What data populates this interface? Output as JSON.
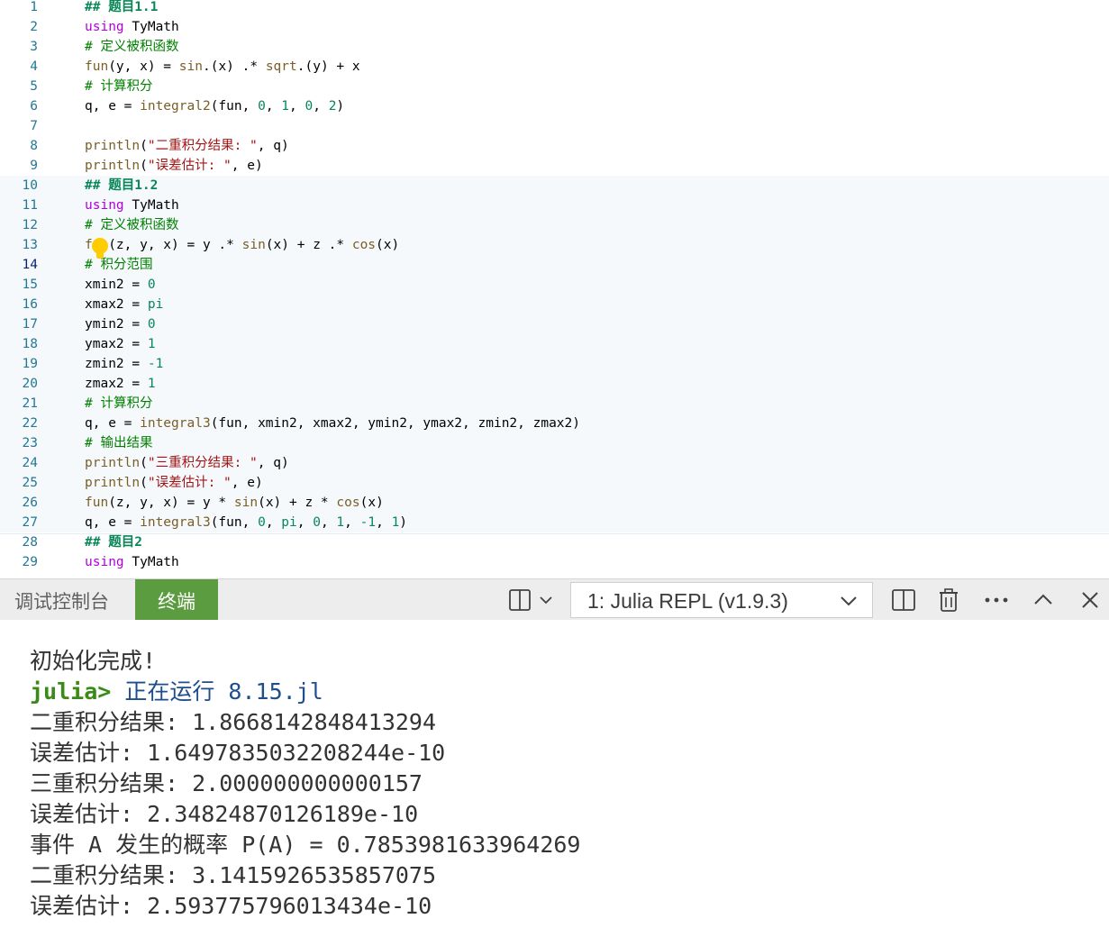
{
  "editor": {
    "lines": [
      {
        "num": "1",
        "code": [
          {
            "t": "## 题目1.1",
            "c": "hd"
          }
        ]
      },
      {
        "num": "2",
        "code": [
          {
            "t": "using",
            "c": "kw"
          },
          {
            "t": " TyMath",
            "c": "tx"
          }
        ]
      },
      {
        "num": "3",
        "code": [
          {
            "t": "# 定义被积函数",
            "c": "cm"
          }
        ]
      },
      {
        "num": "4",
        "code": [
          {
            "t": "fun",
            "c": "fn"
          },
          {
            "t": "(y, x) = ",
            "c": "tx"
          },
          {
            "t": "sin",
            "c": "fn"
          },
          {
            "t": ".(x) .* ",
            "c": "tx"
          },
          {
            "t": "sqrt",
            "c": "fn"
          },
          {
            "t": ".(y) + x",
            "c": "tx"
          }
        ]
      },
      {
        "num": "5",
        "code": [
          {
            "t": "# 计算积分",
            "c": "cm"
          }
        ]
      },
      {
        "num": "6",
        "code": [
          {
            "t": "q, e = ",
            "c": "tx"
          },
          {
            "t": "integral2",
            "c": "fn"
          },
          {
            "t": "(fun, ",
            "c": "tx"
          },
          {
            "t": "0",
            "c": "nm"
          },
          {
            "t": ", ",
            "c": "tx"
          },
          {
            "t": "1",
            "c": "nm"
          },
          {
            "t": ", ",
            "c": "tx"
          },
          {
            "t": "0",
            "c": "nm"
          },
          {
            "t": ", ",
            "c": "tx"
          },
          {
            "t": "2",
            "c": "nm"
          },
          {
            "t": ")",
            "c": "tx"
          }
        ]
      },
      {
        "num": "7",
        "code": []
      },
      {
        "num": "8",
        "code": [
          {
            "t": "println",
            "c": "fn"
          },
          {
            "t": "(",
            "c": "tx"
          },
          {
            "t": "\"二重积分结果: \"",
            "c": "st"
          },
          {
            "t": ", q)",
            "c": "tx"
          }
        ]
      },
      {
        "num": "9",
        "code": [
          {
            "t": "println",
            "c": "fn"
          },
          {
            "t": "(",
            "c": "tx"
          },
          {
            "t": "\"误差估计: \"",
            "c": "st"
          },
          {
            "t": ", e)",
            "c": "tx"
          }
        ]
      },
      {
        "num": "10",
        "code": [
          {
            "t": "## 题目1.2",
            "c": "hd"
          }
        ]
      },
      {
        "num": "11",
        "code": [
          {
            "t": "using",
            "c": "kw"
          },
          {
            "t": " TyMath",
            "c": "tx"
          }
        ]
      },
      {
        "num": "12",
        "code": [
          {
            "t": "# 定义被积函数",
            "c": "cm"
          }
        ]
      },
      {
        "num": "13",
        "code": [
          {
            "t": "f  ",
            "c": "fn"
          },
          {
            "t": "(z, y, x) = y .* ",
            "c": "tx"
          },
          {
            "t": "sin",
            "c": "fn"
          },
          {
            "t": "(x) + z .* ",
            "c": "tx"
          },
          {
            "t": "cos",
            "c": "fn"
          },
          {
            "t": "(x)",
            "c": "tx"
          }
        ]
      },
      {
        "num": "14",
        "code": [
          {
            "t": "# 积分范围",
            "c": "cm"
          }
        ]
      },
      {
        "num": "15",
        "code": [
          {
            "t": "xmin2 = ",
            "c": "tx"
          },
          {
            "t": "0",
            "c": "nm"
          }
        ]
      },
      {
        "num": "16",
        "code": [
          {
            "t": "xmax2 = ",
            "c": "tx"
          },
          {
            "t": "pi",
            "c": "nm"
          }
        ]
      },
      {
        "num": "17",
        "code": [
          {
            "t": "ymin2 = ",
            "c": "tx"
          },
          {
            "t": "0",
            "c": "nm"
          }
        ]
      },
      {
        "num": "18",
        "code": [
          {
            "t": "ymax2 = ",
            "c": "tx"
          },
          {
            "t": "1",
            "c": "nm"
          }
        ]
      },
      {
        "num": "19",
        "code": [
          {
            "t": "zmin2 = ",
            "c": "tx"
          },
          {
            "t": "-1",
            "c": "nm"
          }
        ]
      },
      {
        "num": "20",
        "code": [
          {
            "t": "zmax2 = ",
            "c": "tx"
          },
          {
            "t": "1",
            "c": "nm"
          }
        ]
      },
      {
        "num": "21",
        "code": [
          {
            "t": "# 计算积分",
            "c": "cm"
          }
        ]
      },
      {
        "num": "22",
        "code": [
          {
            "t": "q, e = ",
            "c": "tx"
          },
          {
            "t": "integral3",
            "c": "fn"
          },
          {
            "t": "(fun, xmin2, xmax2, ymin2, ymax2, zmin2, zmax2)",
            "c": "tx"
          }
        ]
      },
      {
        "num": "23",
        "code": [
          {
            "t": "# 输出结果",
            "c": "cm"
          }
        ]
      },
      {
        "num": "24",
        "code": [
          {
            "t": "println",
            "c": "fn"
          },
          {
            "t": "(",
            "c": "tx"
          },
          {
            "t": "\"三重积分结果: \"",
            "c": "st"
          },
          {
            "t": ", q)",
            "c": "tx"
          }
        ]
      },
      {
        "num": "25",
        "code": [
          {
            "t": "println",
            "c": "fn"
          },
          {
            "t": "(",
            "c": "tx"
          },
          {
            "t": "\"误差估计: \"",
            "c": "st"
          },
          {
            "t": ", e)",
            "c": "tx"
          }
        ]
      },
      {
        "num": "26",
        "code": [
          {
            "t": "fun",
            "c": "fn"
          },
          {
            "t": "(z, y, x) = y * ",
            "c": "tx"
          },
          {
            "t": "sin",
            "c": "fn"
          },
          {
            "t": "(x) + z * ",
            "c": "tx"
          },
          {
            "t": "cos",
            "c": "fn"
          },
          {
            "t": "(x)",
            "c": "tx"
          }
        ]
      },
      {
        "num": "27",
        "code": [
          {
            "t": "q, e = ",
            "c": "tx"
          },
          {
            "t": "integral3",
            "c": "fn"
          },
          {
            "t": "(fun, ",
            "c": "tx"
          },
          {
            "t": "0",
            "c": "nm"
          },
          {
            "t": ", ",
            "c": "tx"
          },
          {
            "t": "pi",
            "c": "nm"
          },
          {
            "t": ", ",
            "c": "tx"
          },
          {
            "t": "0",
            "c": "nm"
          },
          {
            "t": ", ",
            "c": "tx"
          },
          {
            "t": "1",
            "c": "nm"
          },
          {
            "t": ", ",
            "c": "tx"
          },
          {
            "t": "-1",
            "c": "nm"
          },
          {
            "t": ", ",
            "c": "tx"
          },
          {
            "t": "1",
            "c": "nm"
          },
          {
            "t": ")",
            "c": "tx"
          }
        ]
      },
      {
        "num": "28",
        "code": [
          {
            "t": "## 题目2",
            "c": "hd"
          }
        ]
      },
      {
        "num": "29",
        "code": [
          {
            "t": "using",
            "c": "kw"
          },
          {
            "t": " TyMath",
            "c": "tx"
          }
        ]
      }
    ],
    "current_line": "14"
  },
  "panel": {
    "tab_debug": "调试控制台",
    "tab_terminal": "终端",
    "terminal_select": "1: Julia REPL (v1.9.3)",
    "icons": [
      "split-layout-icon",
      "chevron-down-icon",
      "split-editor-icon",
      "trash-icon",
      "more-icon",
      "chevron-up-icon",
      "close-icon"
    ]
  },
  "terminal": {
    "line1": "初始化完成!",
    "prompt": "julia>",
    "run_text": " 正在运行 8.15.jl",
    "line3": "二重积分结果: 1.8668142848413294",
    "line4": "误差估计: 1.6497835032208244e-10",
    "line5": "三重积分结果: 2.000000000000157",
    "line6": "误差估计: 2.34824870126189e-10",
    "line7": "事件 A 发生的概率 P(A) = 0.7853981633964269",
    "line8": "二重积分结果: 3.1415926535857075",
    "line9": "误差估计: 2.593775796013434e-10"
  }
}
